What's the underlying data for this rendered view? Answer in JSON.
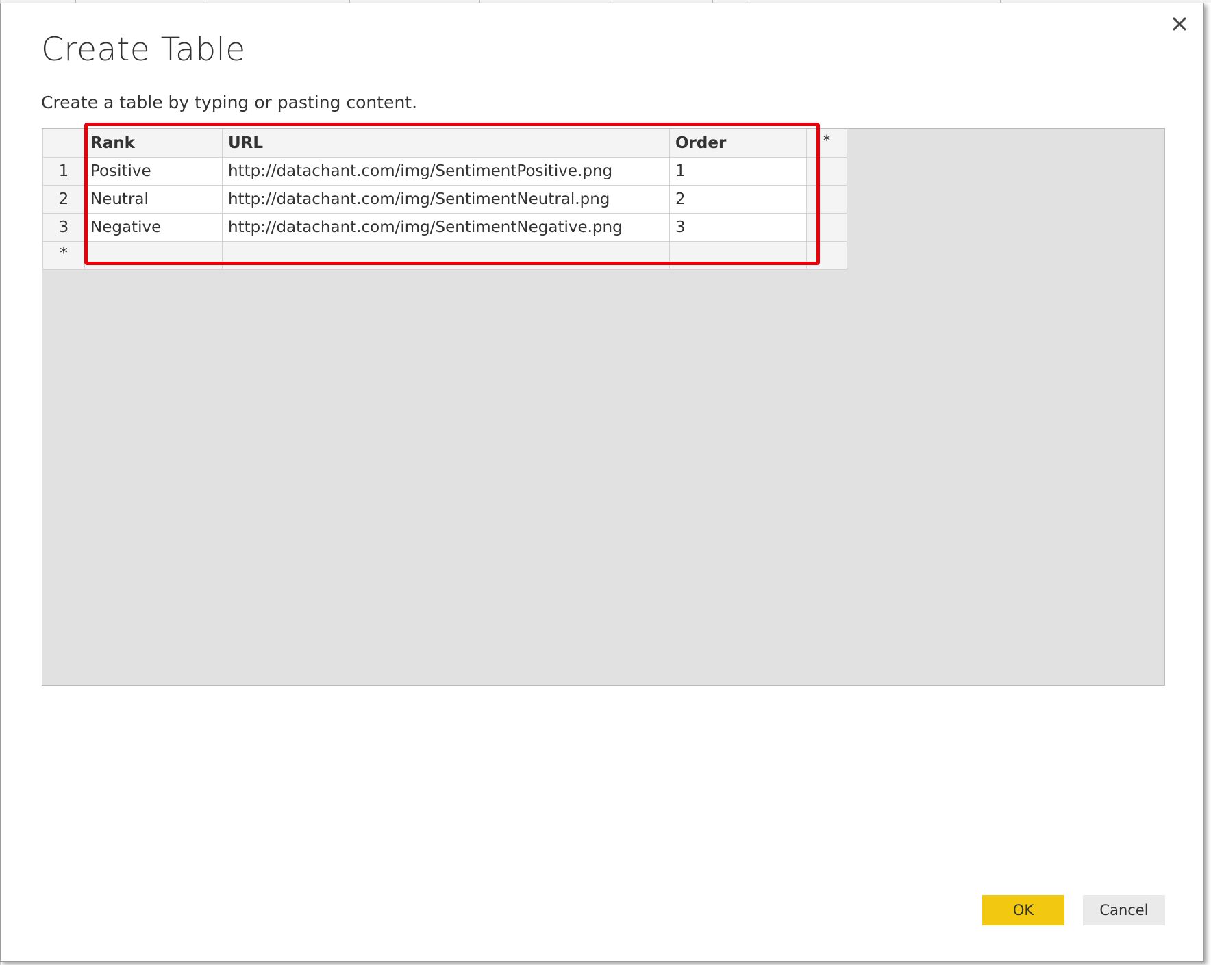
{
  "dialog": {
    "title": "Create Table",
    "subtitle": "Create a table by typing or pasting content.",
    "close_icon": "close-icon"
  },
  "table": {
    "columns": [
      "Rank",
      "URL",
      "Order"
    ],
    "add_column_marker": "*",
    "rows": [
      {
        "num": "1",
        "cells": [
          "Positive",
          "http://datachant.com/img/SentimentPositive.png",
          "1"
        ]
      },
      {
        "num": "2",
        "cells": [
          "Neutral",
          "http://datachant.com/img/SentimentNeutral.png",
          "2"
        ]
      },
      {
        "num": "3",
        "cells": [
          "Negative",
          "http://datachant.com/img/SentimentNegative.png",
          "3"
        ]
      }
    ],
    "new_row_marker": "*"
  },
  "annotation": {
    "highlight_color": "#e8000b"
  },
  "buttons": {
    "ok_label": "OK",
    "cancel_label": "Cancel",
    "ok_color": "#f2c811"
  }
}
